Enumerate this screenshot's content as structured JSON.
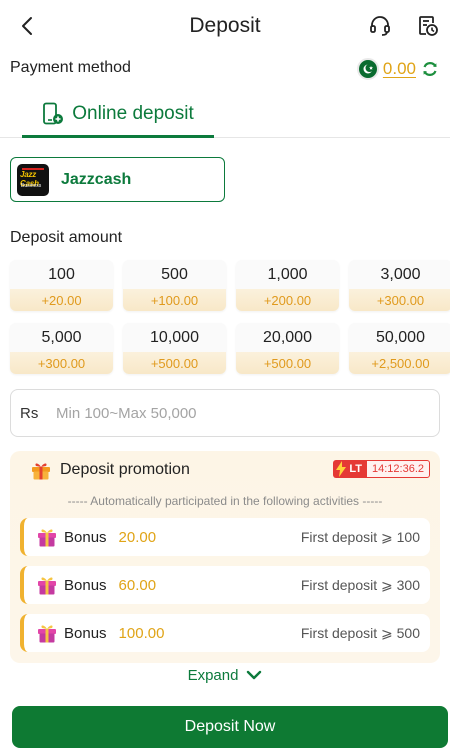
{
  "header": {
    "title": "Deposit"
  },
  "payment": {
    "label": "Payment method",
    "balance": "0.00"
  },
  "tabs": {
    "online": "Online deposit"
  },
  "method": {
    "name": "Jazzcash",
    "logo_text_top": "Jazz Cash",
    "logo_text_bottom": "Business"
  },
  "amount": {
    "label": "Deposit amount",
    "options": [
      {
        "value": "100",
        "bonus": "+20.00"
      },
      {
        "value": "500",
        "bonus": "+100.00"
      },
      {
        "value": "1,000",
        "bonus": "+200.00"
      },
      {
        "value": "3,000",
        "bonus": "+300.00"
      },
      {
        "value": "5,000",
        "bonus": "+300.00"
      },
      {
        "value": "10,000",
        "bonus": "+500.00"
      },
      {
        "value": "20,000",
        "bonus": "+500.00"
      },
      {
        "value": "50,000",
        "bonus": "+2,500.00"
      }
    ],
    "currency": "Rs",
    "placeholder": "Min 100~Max 50,000"
  },
  "promotion": {
    "title": "Deposit promotion",
    "lt_badge": "LT",
    "timer": "14:12:36.2",
    "note": "----- Automatically participated in the following activities -----",
    "bonuses": [
      {
        "label": "Bonus",
        "amount": "20.00",
        "condition": "First deposit ⩾ 100"
      },
      {
        "label": "Bonus",
        "amount": "60.00",
        "condition": "First deposit ⩾ 300"
      },
      {
        "label": "Bonus",
        "amount": "100.00",
        "condition": "First deposit ⩾ 500"
      }
    ]
  },
  "expand_label": "Expand",
  "submit_label": "Deposit Now",
  "colors": {
    "brand_green": "#0c7a3c",
    "gold": "#e0a417",
    "bonus_orange": "#e09a1d",
    "alert_red": "#e53935"
  }
}
